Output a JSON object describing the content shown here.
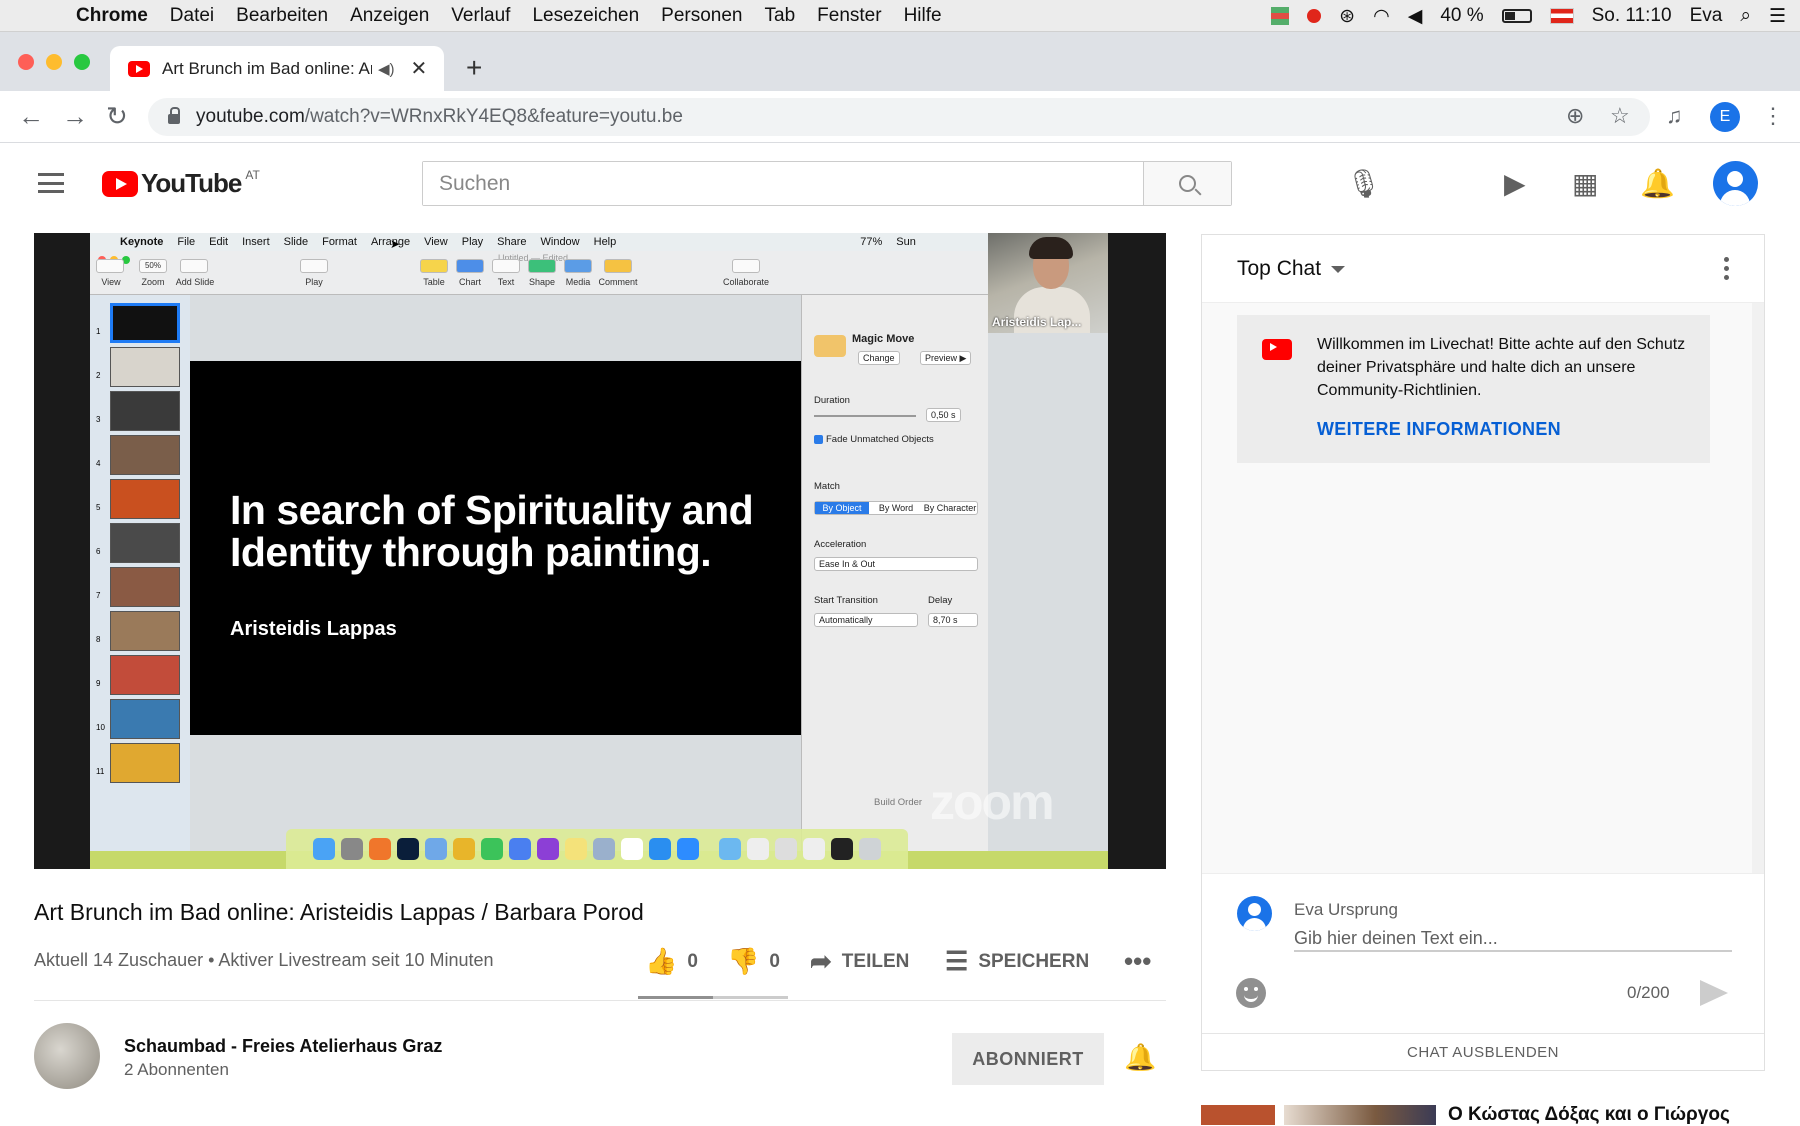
{
  "macos": {
    "apple": "",
    "app_name": "Chrome",
    "menus": [
      "Datei",
      "Bearbeiten",
      "Anzeigen",
      "Verlauf",
      "Lesezeichen",
      "Personen",
      "Tab",
      "Fenster",
      "Hilfe"
    ],
    "battery": "40 %",
    "clock": "So. 11:10",
    "user": "Eva"
  },
  "browser": {
    "tab_title": "Art Brunch im Bad online: Aristeidis Lappas / Barbara Porod",
    "url_host": "youtube.com",
    "url_path": "/watch?v=WRnxRkY4EQ8&feature=youtu.be",
    "profile_initial": "E"
  },
  "youtube": {
    "logo_text": "YouTube",
    "country": "AT",
    "search_placeholder": "Suchen"
  },
  "video": {
    "keynote_menus": [
      "Keynote",
      "File",
      "Edit",
      "Insert",
      "Slide",
      "Format",
      "Arrange",
      "View",
      "Play",
      "Share",
      "Window",
      "Help"
    ],
    "keynote_status": "77%",
    "keynote_day": "Sun",
    "doc_title": "Untitled — Edited",
    "toolbar": [
      "View",
      "Zoom",
      "Add Slide",
      "Play",
      "Table",
      "Chart",
      "Text",
      "Shape",
      "Media",
      "Comment",
      "Collaborate"
    ],
    "zoom_value": "50%",
    "slide_numbers": [
      "1",
      "2",
      "3",
      "4",
      "5",
      "6",
      "7",
      "8",
      "9",
      "10",
      "11"
    ],
    "slide_title": "In search of Spirituality and Identity through painting.",
    "slide_author": "Aristeidis Lappas",
    "inspector": {
      "effect": "Magic Move",
      "change": "Change",
      "preview": "Preview ▶",
      "duration_label": "Duration",
      "duration_value": "0,50 s",
      "fade_label": "Fade Unmatched Objects",
      "match_label": "Match",
      "match_options": [
        "By Object",
        "By Word",
        "By Character"
      ],
      "acceleration_label": "Acceleration",
      "acceleration_value": "Ease In & Out",
      "start_label": "Start Transition",
      "start_value": "Automatically",
      "delay_label": "Delay",
      "delay_value": "8,70 s",
      "build_order": "Build Order"
    },
    "camera_name": "Aristeidis Lap...",
    "zoom_watermark": "zoom"
  },
  "info": {
    "title": "Art Brunch im Bad online: Aristeidis Lappas / Barbara Porod",
    "views": "Aktuell 14 Zuschauer • Aktiver Livestream seit 10 Minuten",
    "likes": "0",
    "dislikes": "0",
    "share": "TEILEN",
    "save": "SPEICHERN",
    "like_ratio": 0.5
  },
  "channel": {
    "name": "Schaumbad - Freies Atelierhaus Graz",
    "subscribers": "2 Abonnenten",
    "subscribe_label": "ABONNIERT"
  },
  "chat": {
    "mode": "Top Chat",
    "welcome": "Willkommen im Livechat! Bitte achte auf den Schutz deiner Privatsphäre und halte dich an unsere Community-Richtlinien.",
    "welcome_link": "WEITERE INFORMATIONEN",
    "user": "Eva Ursprung",
    "input_placeholder": "Gib hier deinen Text ein...",
    "counter": "0/200",
    "hide": "CHAT AUSBLENDEN"
  },
  "recommendation": {
    "title": "Ο Κώστας Δόξας και ο Γιώργος"
  }
}
